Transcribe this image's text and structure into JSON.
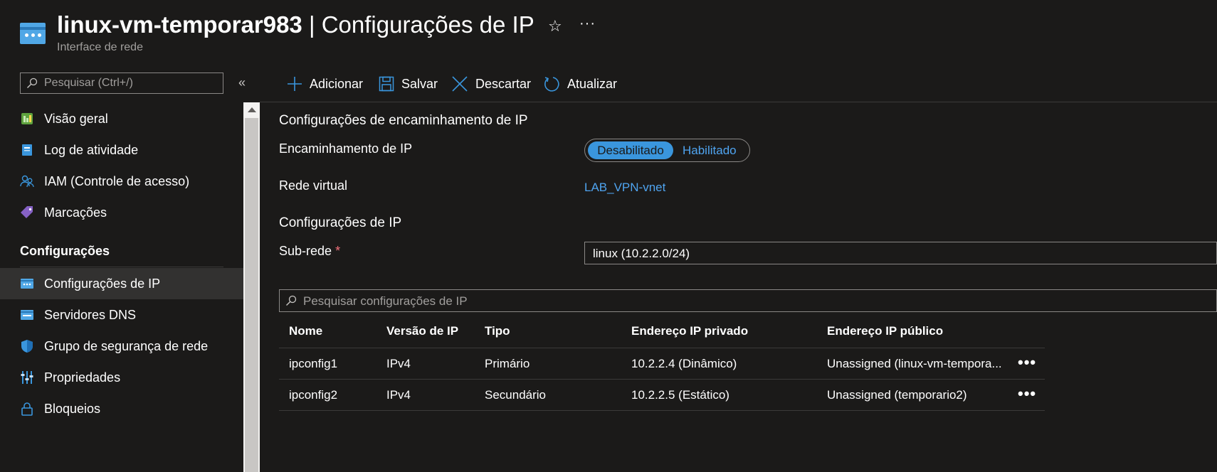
{
  "header": {
    "resource_name": "linux-vm-temporar983",
    "separator": " | ",
    "page_name": "Configurações de IP",
    "subtitle": "Interface de rede",
    "star_icon": "☆",
    "more_icon": "···"
  },
  "sidebar": {
    "search_placeholder": "Pesquisar (Ctrl+/)",
    "collapse_icon": "«",
    "items": [
      {
        "label": "Visão geral",
        "icon": "overview-icon"
      },
      {
        "label": "Log de atividade",
        "icon": "activity-log-icon"
      },
      {
        "label": "IAM (Controle de acesso)",
        "icon": "iam-icon"
      },
      {
        "label": "Marcações",
        "icon": "tag-icon"
      }
    ],
    "section_title": "Configurações",
    "section_items": [
      {
        "label": "Configurações de IP",
        "icon": "ip-config-icon",
        "active": true
      },
      {
        "label": "Servidores DNS",
        "icon": "dns-icon"
      },
      {
        "label": "Grupo de segurança de rede",
        "icon": "shield-icon"
      },
      {
        "label": "Propriedades",
        "icon": "properties-icon"
      },
      {
        "label": "Bloqueios",
        "icon": "lock-icon"
      }
    ]
  },
  "toolbar": {
    "add_label": "Adicionar",
    "save_label": "Salvar",
    "discard_label": "Descartar",
    "refresh_label": "Atualizar"
  },
  "form": {
    "forwarding_section": "Configurações de encaminhamento de IP",
    "forwarding_label": "Encaminhamento de IP",
    "toggle_off": "Desabilitado",
    "toggle_on": "Habilitado",
    "toggle_selected": "Desabilitado",
    "vnet_label": "Rede virtual",
    "vnet_link": "LAB_VPN-vnet",
    "ip_section": "Configurações de IP",
    "subnet_label": "Sub-rede",
    "required_mark": "*",
    "subnet_value": "linux (10.2.2.0/24)",
    "table_search_placeholder": "Pesquisar configurações de IP"
  },
  "table": {
    "columns": [
      "Nome",
      "Versão de IP",
      "Tipo",
      "Endereço IP privado",
      "Endereço IP público"
    ],
    "rows": [
      [
        "ipconfig1",
        "IPv4",
        "Primário",
        "10.2.2.4 (Dinâmico)",
        "Unassigned (linux-vm-tempora..."
      ],
      [
        "ipconfig2",
        "IPv4",
        "Secundário",
        "10.2.2.5 (Estático)",
        "Unassigned (temporario2)"
      ]
    ],
    "row_menu_icon": "•••"
  },
  "colors": {
    "background": "#1b1a19",
    "accent": "#3a96dd",
    "link": "#4fa4f0",
    "required": "#f1707b"
  }
}
